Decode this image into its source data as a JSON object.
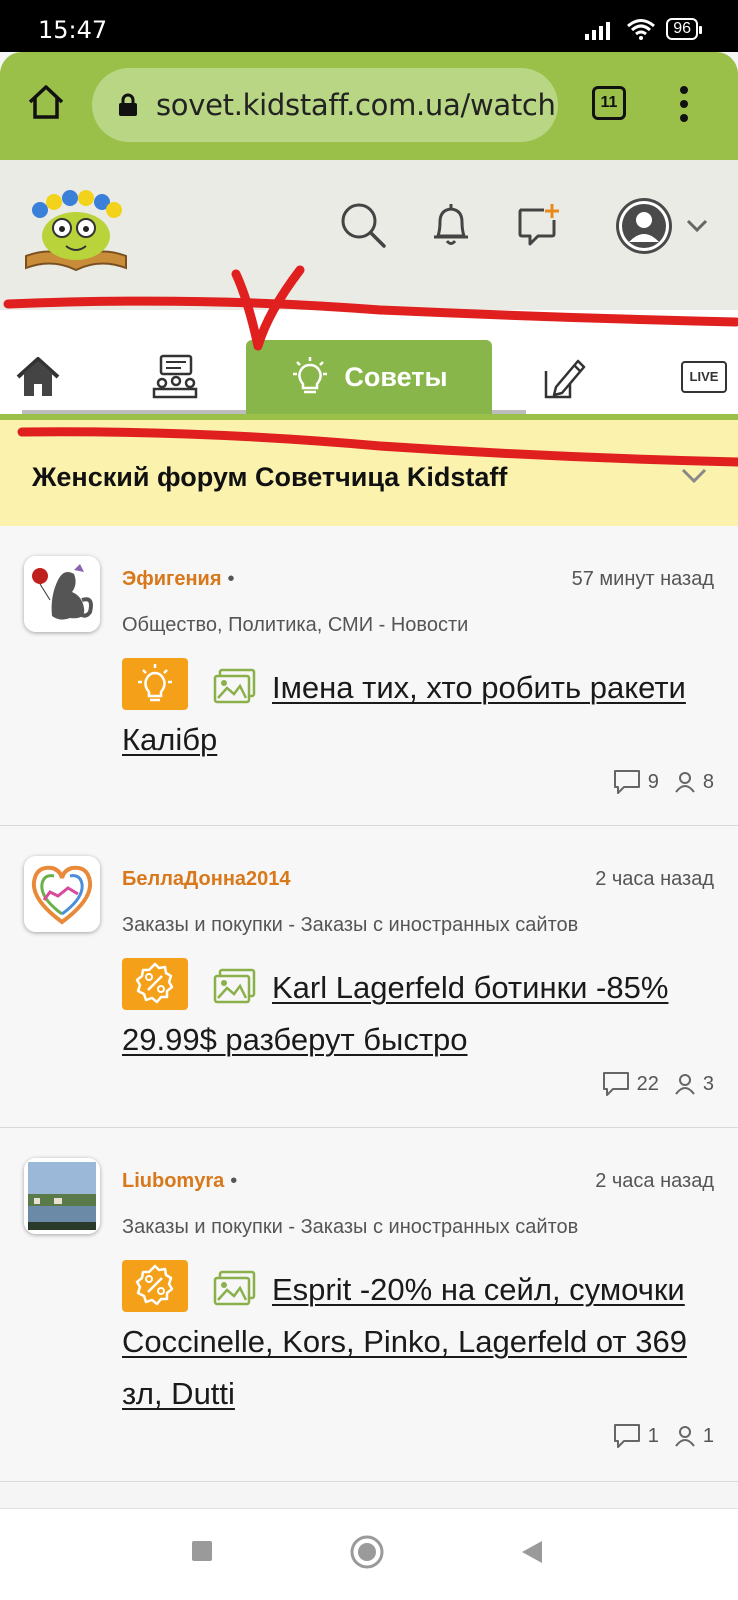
{
  "status": {
    "time": "15:47",
    "battery": "96"
  },
  "browser": {
    "url": "sovet.kidstaff.com.ua/watch",
    "tab_count": "11"
  },
  "nav": {
    "active_tab_label": "Советы",
    "live_label": "LIVE"
  },
  "forum": {
    "title": "Женский форум Советчица Kidstaff"
  },
  "posts": [
    {
      "author": "Эфигения",
      "time": "57 минут назад",
      "category": "Общество, Политика, СМИ - Новости",
      "badge": "lightbulb-icon",
      "title": "Імена тих, хто робить ракети Калібр",
      "comments": "9",
      "participants": "8"
    },
    {
      "author": "БеллаДонна2014",
      "time": "2 часа назад",
      "category": "Заказы и покупки - Заказы с иностранных сайтов",
      "badge": "percent-icon",
      "title": "Karl Lagerfeld ботинки -85% 29.99$ разберут быстро",
      "comments": "22",
      "participants": "3"
    },
    {
      "author": "Liubomyra",
      "time": "2 часа назад",
      "category": "Заказы и покупки - Заказы с иностранных сайтов",
      "badge": "percent-icon",
      "title": "Esprit -20% на сейл, сумочки Coccinelle, Kors, Pinko, Lagerfeld от 369 зл, Dutti",
      "comments": "1",
      "participants": "1"
    }
  ],
  "colors": {
    "browser_green": "#9ac04a",
    "accent_orange": "#f4a019",
    "author_orange": "#d8781a",
    "forum_bar": "#fbf3ad"
  }
}
